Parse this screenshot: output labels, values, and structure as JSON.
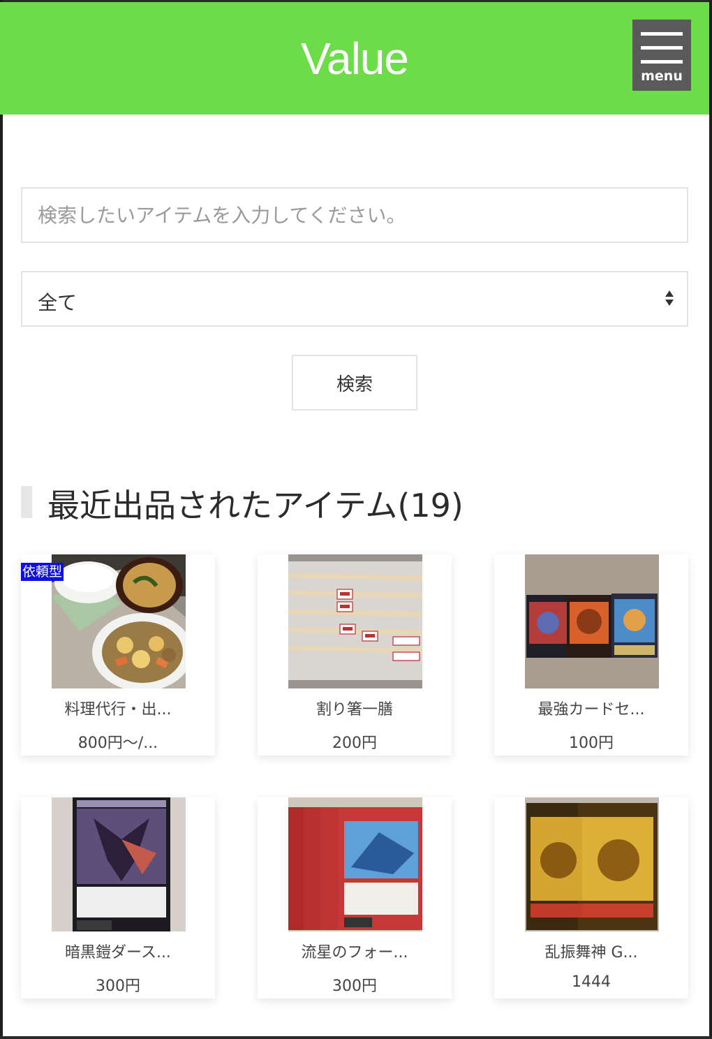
{
  "header": {
    "logo": "Value",
    "menu_label": "menu"
  },
  "search": {
    "placeholder": "検索したいアイテムを入力してください。",
    "value": "",
    "category_selected": "全て",
    "button_label": "検索"
  },
  "section": {
    "title": "最近出品されたアイテム(19)"
  },
  "items": [
    {
      "name": "料理代行・出...",
      "price": "800円〜/...",
      "badge": "依頼型",
      "image": "food-dish"
    },
    {
      "name": "割り箸一膳",
      "price": "200円",
      "image": "chopsticks"
    },
    {
      "name": "最強カードセ...",
      "price": "100円",
      "image": "card-set"
    },
    {
      "name": "暗黒鎧ダース...",
      "price": "300円",
      "image": "dark-card"
    },
    {
      "name": "流星のフォー...",
      "price": "300円",
      "image": "red-cards"
    },
    {
      "name": "乱振舞神 G...",
      "price": "1444",
      "image": "gold-cards"
    }
  ],
  "colors": {
    "header_bg": "#6cdc48",
    "menu_bg": "#5a5a5a",
    "badge_bg": "#1010e0"
  }
}
